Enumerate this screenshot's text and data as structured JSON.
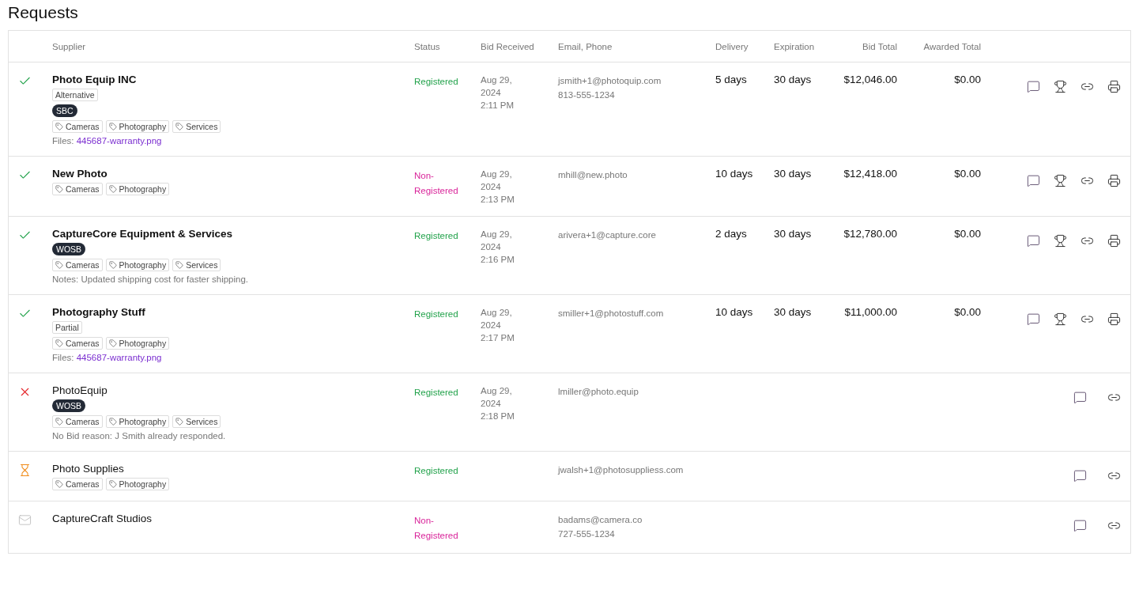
{
  "title": "Requests",
  "columns": [
    "Supplier",
    "Status",
    "Bid Received",
    "Email, Phone",
    "Delivery",
    "Expiration",
    "Bid Total",
    "Awarded Total"
  ],
  "rows": [
    {
      "kind": "accepted",
      "name": "Photo Equip INC",
      "label": "Alternative",
      "badge": "SBC",
      "tags": [
        "Cameras",
        "Photography",
        "Services"
      ],
      "files_label": "Files:",
      "file": "445687-warranty.png",
      "registered": true,
      "status": "Registered",
      "received": [
        "Aug 29,",
        "2024",
        "2:11 PM"
      ],
      "contact": [
        "jsmith+1@photoquip.com",
        "813-555-1234"
      ],
      "delivery": "5 days",
      "expiration": "30 days",
      "bid_total": "$12,046.00",
      "awarded_total": "$0.00",
      "actions": [
        {
          "kind": "comment"
        },
        {
          "kind": "award"
        },
        {
          "kind": "link"
        },
        {
          "kind": "print"
        }
      ]
    },
    {
      "kind": "accepted",
      "name": "New Photo",
      "tags": [
        "Cameras",
        "Photography"
      ],
      "registered": false,
      "status": "Non-Registered",
      "received": [
        "Aug 29,",
        "2024",
        "2:13 PM"
      ],
      "contact": [
        "mhill@new.photo"
      ],
      "delivery": "10 days",
      "expiration": "30 days",
      "bid_total": "$12,418.00",
      "awarded_total": "$0.00",
      "actions": [
        {
          "kind": "comment"
        },
        {
          "kind": "award"
        },
        {
          "kind": "link"
        },
        {
          "kind": "print"
        }
      ]
    },
    {
      "kind": "accepted",
      "name": "CaptureCore Equipment & Services",
      "badge": "WOSB",
      "tags": [
        "Cameras",
        "Photography",
        "Services"
      ],
      "note": "Notes: Updated shipping cost for faster shipping.",
      "registered": true,
      "status": "Registered",
      "received": [
        "Aug 29,",
        "2024",
        "2:16 PM"
      ],
      "contact": [
        "arivera+1@capture.core"
      ],
      "delivery": "2 days",
      "expiration": "30 days",
      "bid_total": "$12,780.00",
      "awarded_total": "$0.00",
      "actions": [
        {
          "kind": "comment"
        },
        {
          "kind": "award"
        },
        {
          "kind": "link"
        },
        {
          "kind": "print"
        }
      ]
    },
    {
      "kind": "accepted",
      "name": "Photography Stuff",
      "label": "Partial",
      "tags": [
        "Cameras",
        "Photography"
      ],
      "files_label": "Files:",
      "file": "445687-warranty.png",
      "registered": true,
      "status": "Registered",
      "received": [
        "Aug 29,",
        "2024",
        "2:17 PM"
      ],
      "contact": [
        "smiller+1@photostuff.com"
      ],
      "delivery": "10 days",
      "expiration": "30 days",
      "bid_total": "$11,000.00",
      "awarded_total": "$0.00",
      "actions": [
        {
          "kind": "comment"
        },
        {
          "kind": "award"
        },
        {
          "kind": "link"
        },
        {
          "kind": "print"
        }
      ]
    },
    {
      "kind": "declined",
      "name": "PhotoEquip",
      "badge": "WOSB",
      "tags": [
        "Cameras",
        "Photography",
        "Services"
      ],
      "note": "No Bid reason: J Smith already responded.",
      "registered": true,
      "status": "Registered",
      "received": [
        "Aug 29,",
        "2024",
        "2:18 PM"
      ],
      "contact": [
        "lmiller@photo.equip"
      ],
      "actions": [
        {
          "kind": "comment"
        },
        {
          "kind": "link"
        }
      ]
    },
    {
      "kind": "pending",
      "name": "Photo Supplies",
      "tags": [
        "Cameras",
        "Photography"
      ],
      "registered": true,
      "status": "Registered",
      "contact": [
        "jwalsh+1@photosuppliess.com"
      ],
      "actions": [
        {
          "kind": "comment"
        },
        {
          "kind": "link"
        }
      ]
    },
    {
      "kind": "invited",
      "name": "CaptureCraft Studios",
      "registered": false,
      "status": "Non-Registered",
      "contact": [
        "badams@camera.co",
        "727-555-1234"
      ],
      "actions": [
        {
          "kind": "comment"
        },
        {
          "kind": "link"
        }
      ]
    }
  ]
}
